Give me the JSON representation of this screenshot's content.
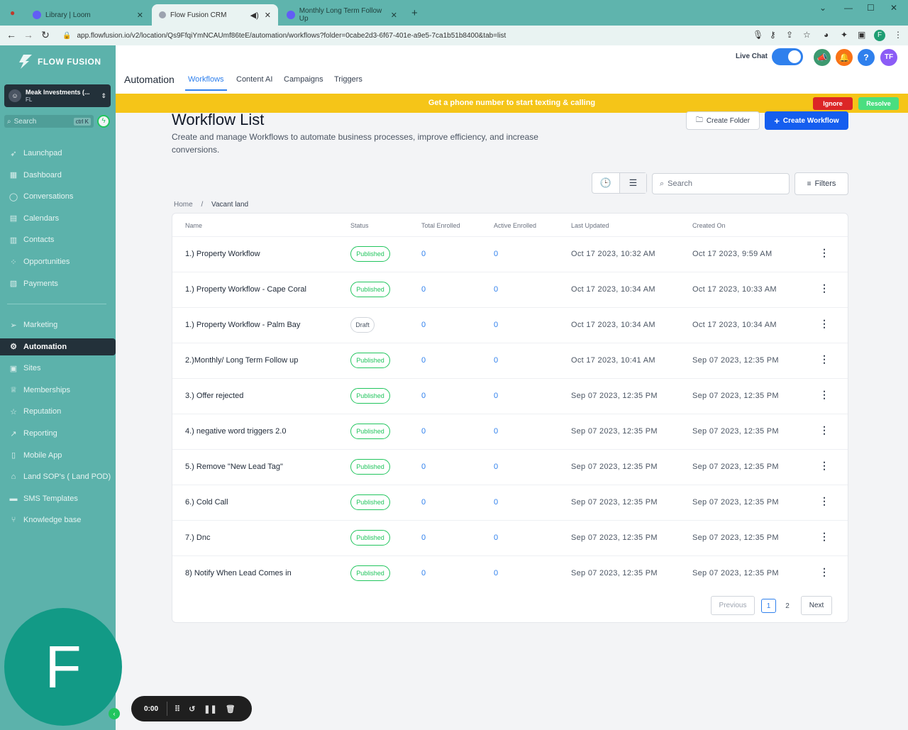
{
  "browser": {
    "tabs": [
      {
        "title": "Library | Loom"
      },
      {
        "title": "Flow Fusion CRM"
      },
      {
        "title": "Monthly Long Term Follow Up"
      }
    ],
    "url": "app.flowfusion.io/v2/location/Qs9FfqiYmNCAUmf86teE/automation/workflows?folder=0cabe2d3-6f67-401e-a9e5-7ca1b51b8400&tab=list",
    "profile_initial": "F"
  },
  "sidebar": {
    "brand": "FLOW FUSION",
    "account": {
      "name": "Meak Investments (...",
      "sub": "FL"
    },
    "search": {
      "placeholder": "Search",
      "shortcut": "ctrl K"
    },
    "items_top": [
      {
        "label": "Launchpad",
        "icon": "rocket-icon"
      },
      {
        "label": "Dashboard",
        "icon": "grid-icon"
      },
      {
        "label": "Conversations",
        "icon": "chat-icon"
      },
      {
        "label": "Calendars",
        "icon": "calendar-icon"
      },
      {
        "label": "Contacts",
        "icon": "contacts-icon"
      },
      {
        "label": "Opportunities",
        "icon": "pipeline-icon"
      },
      {
        "label": "Payments",
        "icon": "receipt-icon"
      }
    ],
    "items_bottom": [
      {
        "label": "Marketing",
        "icon": "send-icon"
      },
      {
        "label": "Automation",
        "icon": "automation-icon",
        "active": true
      },
      {
        "label": "Sites",
        "icon": "sites-icon"
      },
      {
        "label": "Memberships",
        "icon": "membership-icon"
      },
      {
        "label": "Reputation",
        "icon": "star-icon"
      },
      {
        "label": "Reporting",
        "icon": "chart-icon"
      },
      {
        "label": "Mobile App",
        "icon": "phone-icon"
      },
      {
        "label": "Land SOP's ( Land POD)",
        "icon": "house-icon"
      },
      {
        "label": "SMS Templates",
        "icon": "message-icon"
      },
      {
        "label": "Knowledge base",
        "icon": "branch-icon"
      }
    ]
  },
  "header": {
    "live_chat": "Live Chat",
    "section": "Automation",
    "tabs": [
      "Workflows",
      "Content AI",
      "Campaigns",
      "Triggers"
    ],
    "user_initials": "TF"
  },
  "banner": {
    "text": "Get a phone number to start texting & calling",
    "ignore": "Ignore",
    "resolve": "Resolve"
  },
  "page": {
    "title": "Workflow List",
    "subtitle": "Create and manage Workflows to automate business processes, improve efficiency, and increase conversions.",
    "create_folder": "Create Folder",
    "create_workflow": "Create Workflow",
    "search_placeholder": "Search",
    "filters": "Filters",
    "breadcrumb": [
      "Home",
      "/",
      "Vacant land"
    ]
  },
  "table": {
    "headers": [
      "Name",
      "Status",
      "Total Enrolled",
      "Active Enrolled",
      "Last Updated",
      "Created On"
    ],
    "rows": [
      {
        "name": "1.) Property Workflow",
        "status": "Published",
        "total": "0",
        "active": "0",
        "updated": "Oct 17 2023, 10:32 AM",
        "created": "Oct 17 2023, 9:59 AM"
      },
      {
        "name": "1.) Property Workflow  - Cape Coral",
        "status": "Published",
        "total": "0",
        "active": "0",
        "updated": "Oct 17 2023, 10:34 AM",
        "created": "Oct 17 2023, 10:33 AM"
      },
      {
        "name": "1.) Property Workflow  - Palm Bay",
        "status": "Draft",
        "total": "0",
        "active": "0",
        "updated": "Oct 17 2023, 10:34 AM",
        "created": "Oct 17 2023, 10:34 AM"
      },
      {
        "name": "2.)Monthly/ Long Term Follow up",
        "status": "Published",
        "total": "0",
        "active": "0",
        "updated": "Oct 17 2023, 10:41 AM",
        "created": "Sep 07 2023, 12:35 PM"
      },
      {
        "name": "3.) Offer rejected",
        "status": "Published",
        "total": "0",
        "active": "0",
        "updated": "Sep 07 2023, 12:35 PM",
        "created": "Sep 07 2023, 12:35 PM"
      },
      {
        "name": "4.) negative word triggers 2.0",
        "status": "Published",
        "total": "0",
        "active": "0",
        "updated": "Sep 07 2023, 12:35 PM",
        "created": "Sep 07 2023, 12:35 PM"
      },
      {
        "name": "5.) Remove \"New Lead Tag\"",
        "status": "Published",
        "total": "0",
        "active": "0",
        "updated": "Sep 07 2023, 12:35 PM",
        "created": "Sep 07 2023, 12:35 PM"
      },
      {
        "name": "6.) Cold Call",
        "status": "Published",
        "total": "0",
        "active": "0",
        "updated": "Sep 07 2023, 12:35 PM",
        "created": "Sep 07 2023, 12:35 PM"
      },
      {
        "name": "7.) Dnc",
        "status": "Published",
        "total": "0",
        "active": "0",
        "updated": "Sep 07 2023, 12:35 PM",
        "created": "Sep 07 2023, 12:35 PM"
      },
      {
        "name": "8) Notify When Lead Comes in",
        "status": "Published",
        "total": "0",
        "active": "0",
        "updated": "Sep 07 2023, 12:35 PM",
        "created": "Sep 07 2023, 12:35 PM"
      }
    ]
  },
  "pagination": {
    "previous": "Previous",
    "pages": [
      "1",
      "2"
    ],
    "current": "1",
    "next": "Next"
  },
  "overlay": {
    "camera_initial": "F",
    "timer": "0:00"
  }
}
